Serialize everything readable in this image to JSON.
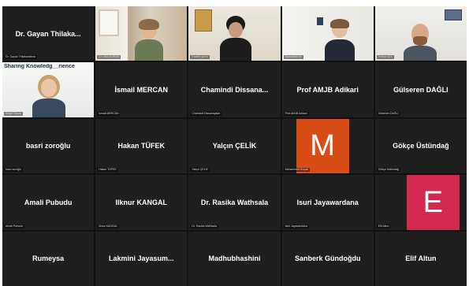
{
  "colors": {
    "avatar_m": "#d84d15",
    "avatar_e": "#d4294e",
    "tile_bg": "#1f1f1f"
  },
  "banner": {
    "text": "Sharing Knowledg__rience"
  },
  "tiles": [
    {
      "name": "Dr. Gayan Thilaka...",
      "tag": "Dr. Gayan Thilakarathna"
    },
    {
      "tag": "Dr. Ulka DURMA"
    },
    {
      "tag": "Kaaeln gbrek"
    },
    {
      "tag": "Kemalettin Er"
    },
    {
      "tag": "Ferhat ÇEL"
    },
    {
      "tag": "Müge Özcan"
    },
    {
      "name": "İsmail MERCAN",
      "tag": "İsmail MERCAN"
    },
    {
      "name": "Chamindi Dissana...",
      "tag": "Chamindi Dissanayake"
    },
    {
      "name": "Prof AMJB Adikari",
      "tag": "Prof AMJB Adikari"
    },
    {
      "name": "Gülseren DAĞLI",
      "tag": "Gülseren DAĞLI"
    },
    {
      "name": "basri zoroğlu",
      "tag": "basri zoroğlu"
    },
    {
      "name": "Hakan TÜFEK",
      "tag": "Hakan TÜFEK"
    },
    {
      "name": "Yalçın ÇELİK",
      "tag": "Yalçın ÇELİK"
    },
    {
      "tag": "Muhammed Koçak",
      "letter": "M"
    },
    {
      "name": "Gökçe Üstündağ",
      "tag": "Gökçe Üstündağ"
    },
    {
      "name": "Amali Pubudu",
      "tag": "Amali Pubudu"
    },
    {
      "name": "Ilknur KANGAL",
      "tag": "Ilknur KANGAL"
    },
    {
      "name": "Dr. Rasika Wathsala",
      "tag": "Dr. Rasika Wathsala"
    },
    {
      "name": "Isuri Jayawardana",
      "tag": "Isuri Jayawardana"
    },
    {
      "tag": "Elif Altun",
      "letter": "E"
    },
    {
      "name": "Rumeysa"
    },
    {
      "name": "Lakmini Jayasum..."
    },
    {
      "name": "Madhubhashini"
    },
    {
      "name": "Sanberk Gündoğdu"
    },
    {
      "name": "Elif Altun"
    }
  ]
}
